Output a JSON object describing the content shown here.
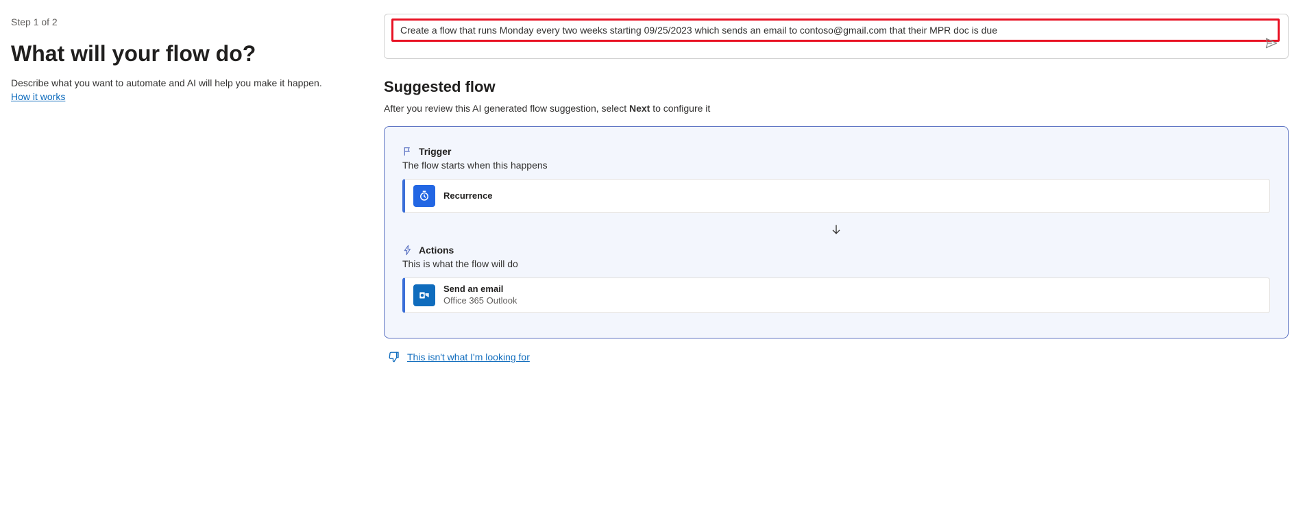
{
  "left": {
    "step_indicator": "Step 1 of 2",
    "title": "What will your flow do?",
    "description": "Describe what you want to automate and AI will help you make it happen.",
    "how_it_works": "How it works"
  },
  "prompt": {
    "text": "Create a flow that runs Monday every two weeks starting 09/25/2023 which sends an email to contoso@gmail.com that their MPR doc is due"
  },
  "suggested": {
    "heading": "Suggested flow",
    "subtext_prefix": "After you review this AI generated flow suggestion, select ",
    "subtext_bold": "Next",
    "subtext_suffix": " to configure it"
  },
  "trigger": {
    "label": "Trigger",
    "subtitle": "The flow starts when this happens",
    "step_title": "Recurrence"
  },
  "actions": {
    "label": "Actions",
    "subtitle": "This is what the flow will do",
    "step_title": "Send an email",
    "step_sub": "Office 365 Outlook"
  },
  "feedback": {
    "link": "This isn't what I'm looking for"
  }
}
